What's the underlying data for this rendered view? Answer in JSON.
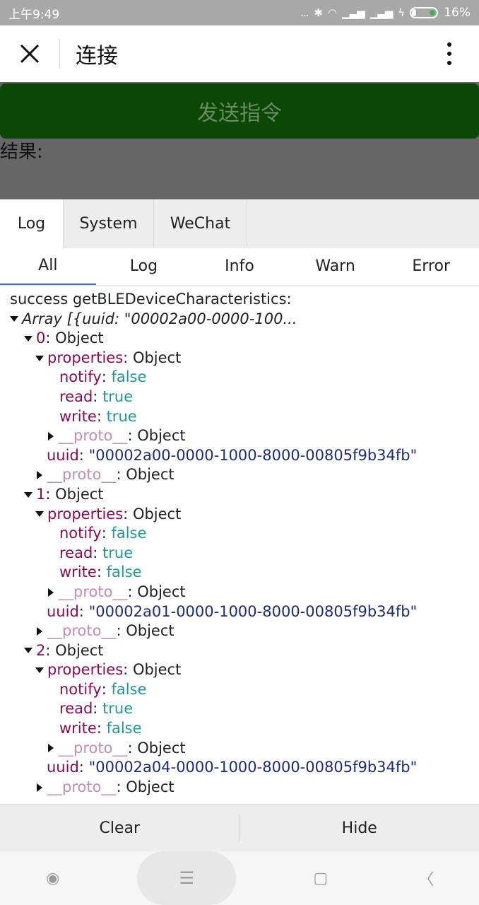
{
  "status_bar": {
    "time": "上午9:49",
    "dots": "...",
    "battery": "16%",
    "battery_level": 0.16
  },
  "navbar": {
    "title": "连接"
  },
  "page": {
    "send_button": "发送指令",
    "result_label": "结果:"
  },
  "console": {
    "tabs": [
      "Log",
      "System",
      "WeChat"
    ],
    "subtabs": [
      "All",
      "Log",
      "Info",
      "Warn",
      "Error"
    ],
    "log": {
      "header": "success getBLEDeviceCharacteristics:",
      "array_label": "Array [{uuid: \"00002a00-0000-100...",
      "items": [
        {
          "index": "0",
          "notify": "false",
          "read": "true",
          "write": "true",
          "uuid": "\"00002a00-0000-1000-8000-00805f9b34fb\""
        },
        {
          "index": "1",
          "notify": "false",
          "read": "true",
          "write": "false",
          "uuid": "\"00002a01-0000-1000-8000-00805f9b34fb\""
        },
        {
          "index": "2",
          "notify": "false",
          "read": "true",
          "write": "false",
          "uuid": "\"00002a04-0000-1000-8000-00805f9b34fb\""
        }
      ],
      "labels": {
        "object": "Object",
        "properties": "properties",
        "proto": "__proto__",
        "notify": "notify",
        "read": "read",
        "write": "write",
        "uuid": "uuid",
        "colon": ":"
      }
    },
    "footer": {
      "clear": "Clear",
      "hide": "Hide"
    }
  },
  "colors": {
    "send_button_bg": "#0b4806",
    "key": "#8b0a55",
    "proto": "#c48db0",
    "boolean": "#1a9a9a",
    "string": "#1c2b7a"
  }
}
